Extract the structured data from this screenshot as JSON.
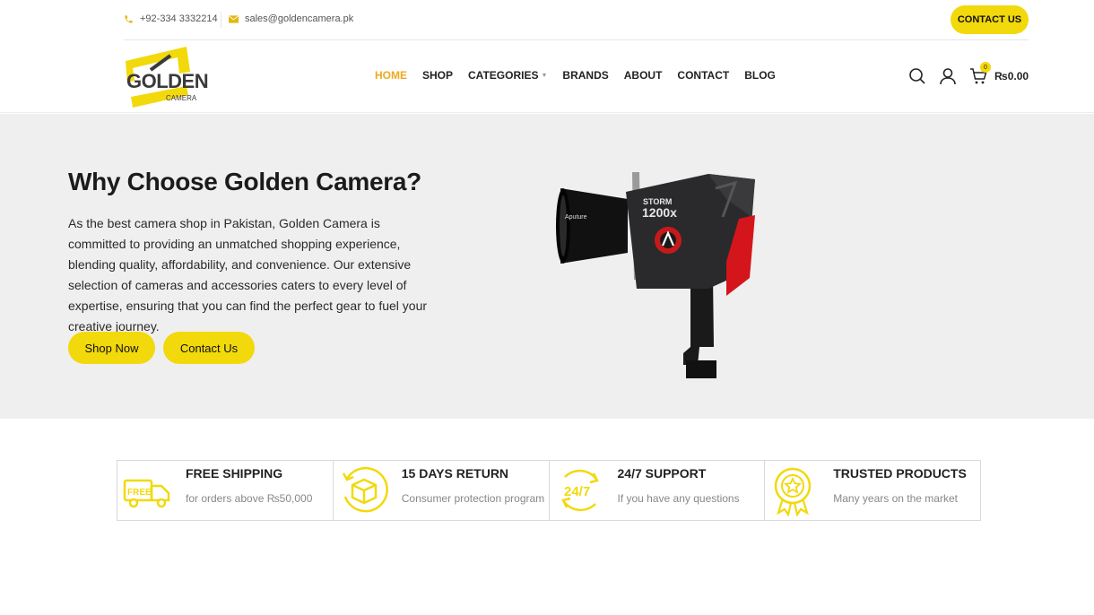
{
  "topbar": {
    "phone": "+92-334 3332214",
    "email": "sales@goldencamera.pk",
    "cta_label": "CONTACT US"
  },
  "logo": {
    "word": "GOLDEN",
    "sub": "CAMERA"
  },
  "nav": {
    "items": [
      {
        "label": "HOME",
        "active": true
      },
      {
        "label": "SHOP"
      },
      {
        "label": "CATEGORIES",
        "has_dropdown": true
      },
      {
        "label": "BRANDS"
      },
      {
        "label": "ABOUT"
      },
      {
        "label": "CONTACT"
      },
      {
        "label": "BLOG"
      }
    ]
  },
  "header_icons": {
    "search": "search-icon",
    "account": "user-icon",
    "cart": "cart-icon",
    "cart_count": "0",
    "cart_total": "₨0.00"
  },
  "hero": {
    "title": "Why Choose Golden Camera?",
    "body": "As the best camera shop in Pakistan, Golden Camera is committed to providing an unmatched shopping experience, blending quality, affordability, and convenience. Our extensive selection of cameras and accessories caters to every level of expertise, ensuring that you can find the perfect gear to fuel your creative journey.",
    "primary_button": "Shop Now",
    "secondary_button": "Contact Us",
    "product_brand": "Aputure",
    "product_model_line1": "STORM",
    "product_model_line2": "1200x"
  },
  "features": [
    {
      "title": "FREE SHIPPING",
      "desc": "for orders above ₨50,000",
      "icon": "free-truck-icon",
      "icon_text": "FREE"
    },
    {
      "title": "15 DAYS RETURN",
      "desc": "Consumer protection program",
      "icon": "return-box-icon"
    },
    {
      "title": "24/7 SUPPORT",
      "desc": "If you have any questions",
      "icon": "support-247-icon",
      "icon_text": "24/7"
    },
    {
      "title": "TRUSTED PRODUCTS",
      "desc": "Many years on the market",
      "icon": "award-badge-icon"
    }
  ],
  "colors": {
    "accent": "#f2d90b",
    "nav_active": "#f0a91f",
    "hero_bg": "#efeff0"
  }
}
